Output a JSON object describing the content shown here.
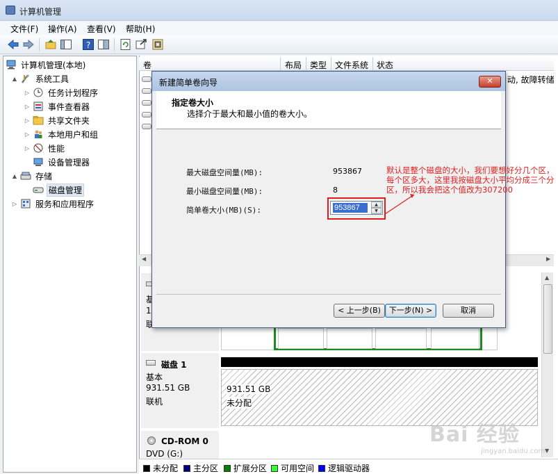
{
  "window": {
    "title": "计算机管理"
  },
  "menu": [
    "文件(F)",
    "操作(A)",
    "查看(V)",
    "帮助(H)"
  ],
  "toolbar_icons": [
    "back-arrow-icon",
    "forward-arrow-icon",
    "up-folder-icon",
    "show-hide-tree-icon",
    "help-icon",
    "properties-icon",
    "refresh-icon",
    "export-icon",
    "settings-icon"
  ],
  "tree": {
    "root": "计算机管理(本地)",
    "items": [
      {
        "label": "系统工具",
        "level": 1,
        "expander": "▲"
      },
      {
        "label": "任务计划程序",
        "level": 2,
        "expander": "▷"
      },
      {
        "label": "事件查看器",
        "level": 2,
        "expander": "▷"
      },
      {
        "label": "共享文件夹",
        "level": 2,
        "expander": "▷"
      },
      {
        "label": "本地用户和组",
        "level": 2,
        "expander": "▷"
      },
      {
        "label": "性能",
        "level": 2,
        "expander": "▷"
      },
      {
        "label": "设备管理器",
        "level": 2,
        "expander": ""
      },
      {
        "label": "存储",
        "level": 1,
        "expander": "▲"
      },
      {
        "label": "磁盘管理",
        "level": 2,
        "expander": "",
        "selected": true
      },
      {
        "label": "服务和应用程序",
        "level": 1,
        "expander": "▷"
      }
    ]
  },
  "columns": [
    "卷",
    "布局",
    "类型",
    "文件系统",
    "状态"
  ],
  "status_overflow": "动, 故障转储",
  "disk0_partial": {
    "line1": "基",
    "line2": "1",
    "line3": "联"
  },
  "disk1": {
    "name": "磁盘 1",
    "type": "基本",
    "size": "931.51 GB",
    "state": "联机",
    "part_size": "931.51 GB",
    "part_label": "未分配"
  },
  "cdrom": {
    "name": "CD-ROM 0",
    "drive": "DVD (G:)"
  },
  "legend": [
    {
      "label": "未分配",
      "color": "#000000"
    },
    {
      "label": "主分区",
      "color": "#000080"
    },
    {
      "label": "扩展分区",
      "color": "#008000"
    },
    {
      "label": "可用空间",
      "color": "#33ff33"
    },
    {
      "label": "逻辑驱动器",
      "color": "#0000ff"
    }
  ],
  "dialog": {
    "title": "新建简单卷向导",
    "close": "✕",
    "header_title": "指定卷大小",
    "header_sub": "选择介于最大和最小值的卷大小。",
    "max_label": "最大磁盘空间量(MB):",
    "max_value": "953867",
    "min_label": "最小磁盘空间量(MB):",
    "min_value": "8",
    "size_label": "简单卷大小(MB)(S):",
    "size_value": "953867",
    "back": "< 上一步(B)",
    "next": "下一步(N) >",
    "cancel": "取消"
  },
  "annotation": "默认是整个磁盘的大小，我们要想好分几个区，每个区多大，这里我按磁盘大小平均分成三个分区，所以我会把这个值改为307200",
  "watermark": {
    "brand": "Bai 经验",
    "url": "jingyan.baidu.com"
  }
}
